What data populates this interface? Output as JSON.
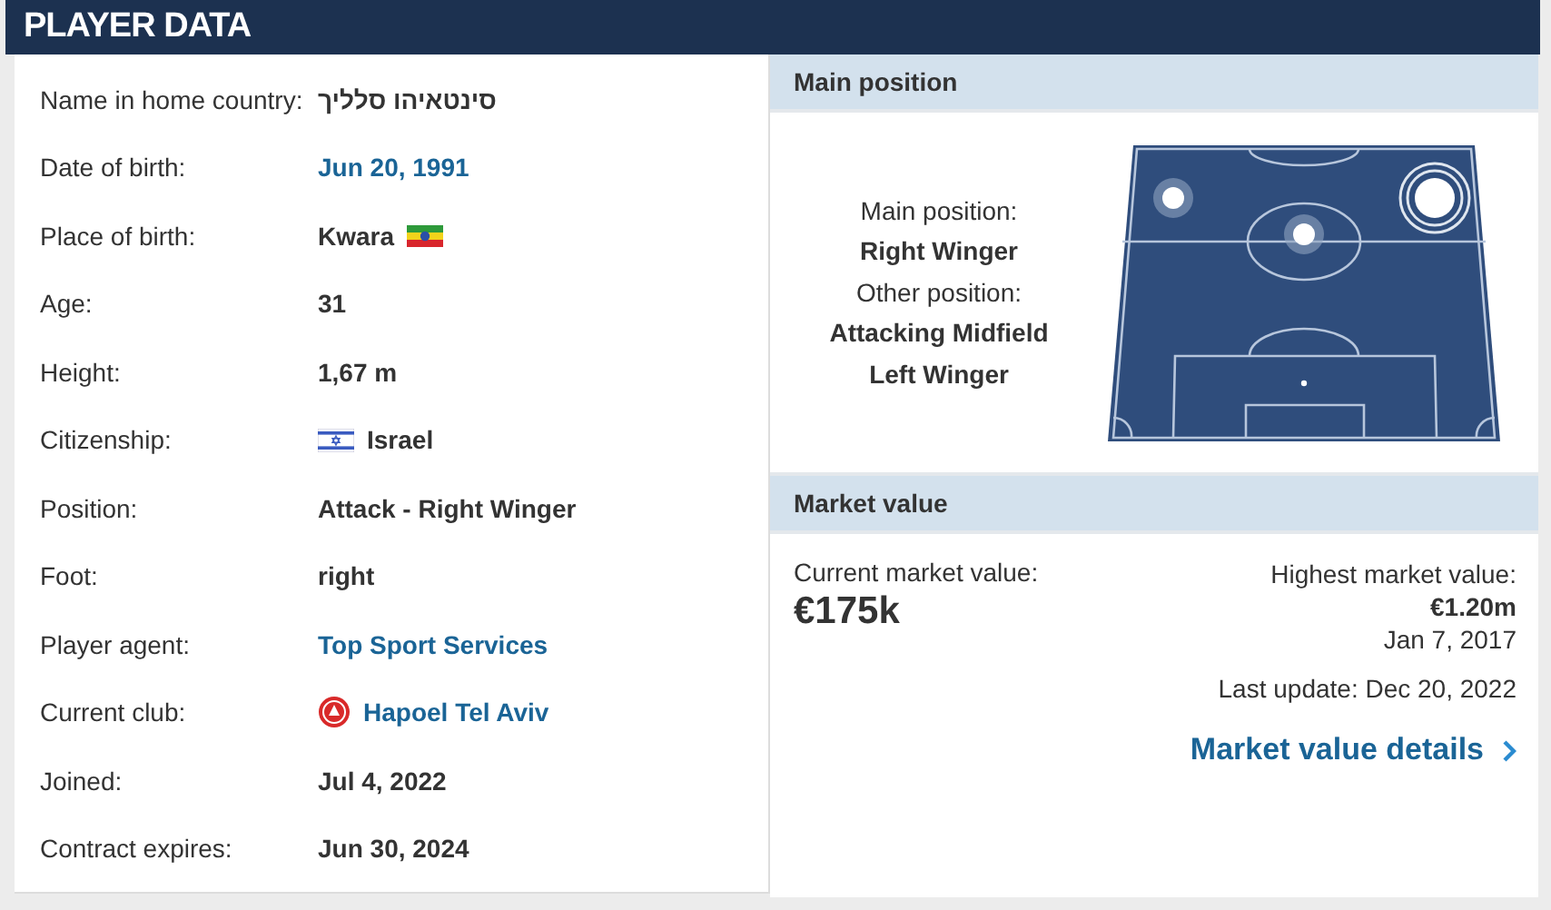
{
  "title": "PLAYER DATA",
  "rows": [
    {
      "label": "Name in home country:",
      "value": "סינטאיהו סלליך",
      "kind": "text"
    },
    {
      "label": "Date of birth:",
      "value": "Jun 20, 1991",
      "kind": "link"
    },
    {
      "label": "Place of birth:",
      "value": "Kwara",
      "kind": "birthplace"
    },
    {
      "label": "Age:",
      "value": "31",
      "kind": "text"
    },
    {
      "label": "Height:",
      "value": "1,67 m",
      "kind": "text"
    },
    {
      "label": "Citizenship:",
      "value": "Israel",
      "kind": "citizenship"
    },
    {
      "label": "Position:",
      "value": "Attack - Right Winger",
      "kind": "text"
    },
    {
      "label": "Foot:",
      "value": "right",
      "kind": "text"
    },
    {
      "label": "Player agent:",
      "value": "Top Sport Services",
      "kind": "link"
    },
    {
      "label": "Current club:",
      "value": "Hapoel Tel Aviv",
      "kind": "club"
    },
    {
      "label": "Joined:",
      "value": "Jul 4, 2022",
      "kind": "text"
    },
    {
      "label": "Contract expires:",
      "value": "Jun 30, 2024",
      "kind": "text"
    }
  ],
  "main_position": {
    "heading": "Main position",
    "main_label": "Main position:",
    "main_positions": [
      {
        "label": "Right Winger"
      }
    ],
    "other_label": "Other position:",
    "other_positions": [
      {
        "label": "Attacking Midfield"
      },
      {
        "label": "Left Winger"
      }
    ]
  },
  "market_value": {
    "heading": "Market value",
    "current_label": "Current market value:",
    "current_value": "€175k",
    "highest_label": "Highest market value:",
    "highest_value": "€1.20m",
    "highest_date": "Jan 7, 2017",
    "last_update": "Last update: Dec 20, 2022",
    "details_link": "Market value details"
  }
}
